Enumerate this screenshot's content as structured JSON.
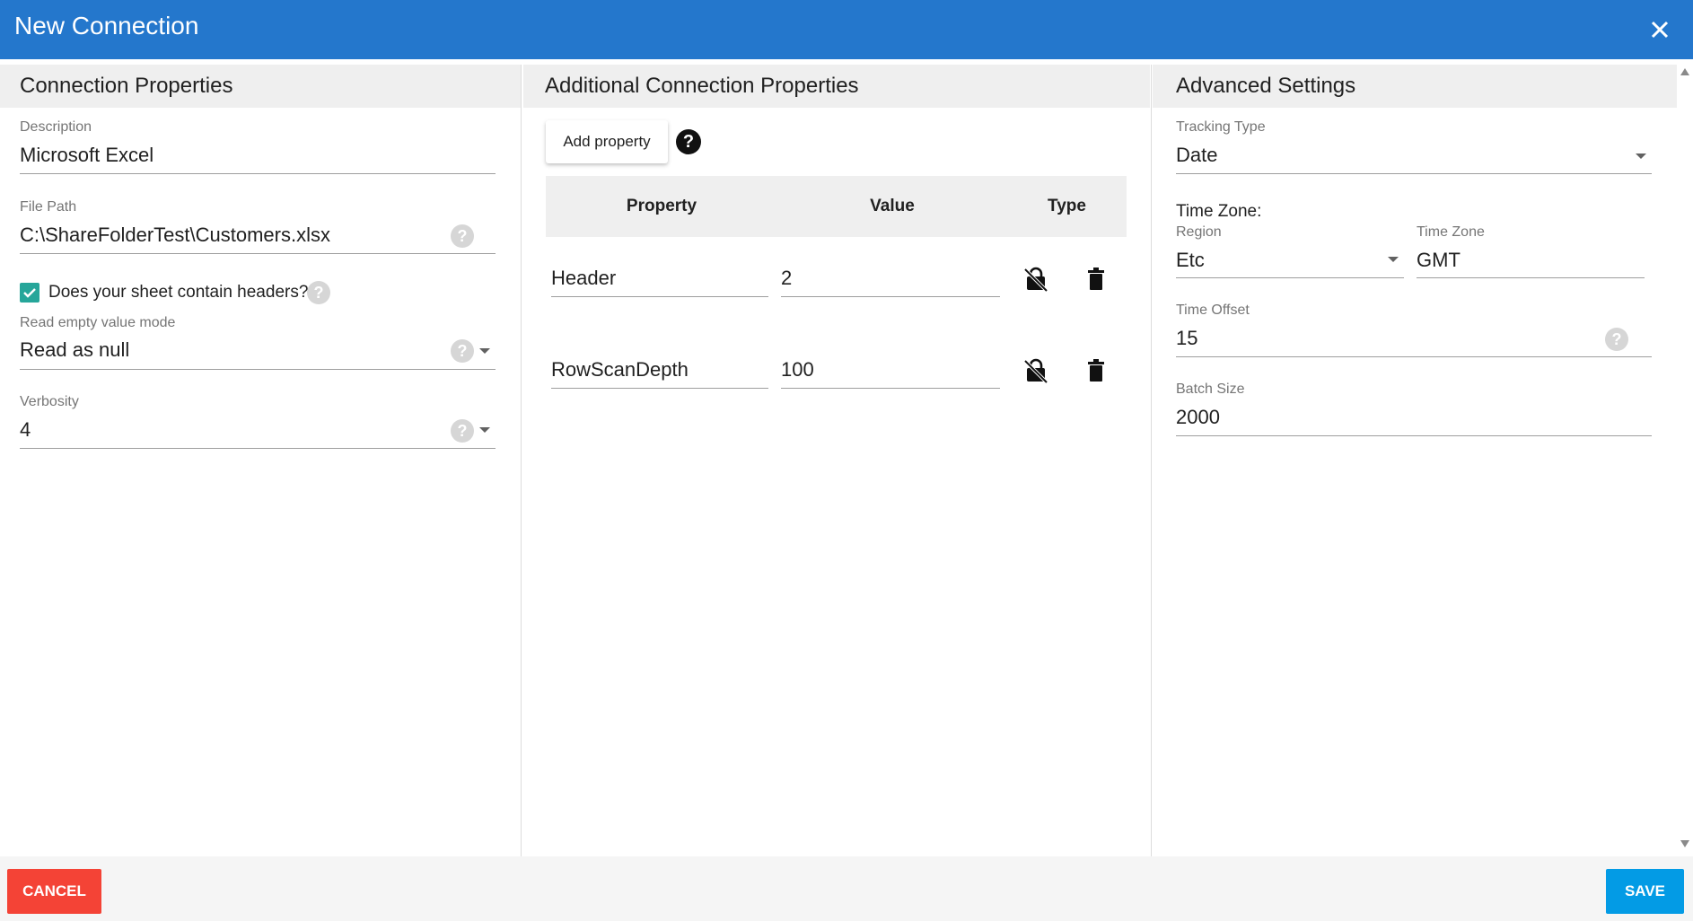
{
  "window": {
    "title": "New Connection",
    "close_icon": "close-icon"
  },
  "colors": {
    "header": "#2477cc",
    "cancel": "#f44336",
    "save": "#039be5",
    "checkbox": "#26a69a"
  },
  "connection_properties": {
    "heading": "Connection Properties",
    "description": {
      "label": "Description",
      "value": "Microsoft Excel"
    },
    "file_path": {
      "label": "File Path",
      "value": "C:\\ShareFolderTest\\Customers.xlsx"
    },
    "headers_checkbox": {
      "label": "Does your sheet contain headers?",
      "checked": true
    },
    "read_empty_mode": {
      "label": "Read empty value mode",
      "value": "Read as null"
    },
    "verbosity": {
      "label": "Verbosity",
      "value": "4"
    }
  },
  "additional_properties": {
    "heading": "Additional Connection Properties",
    "add_button": "Add property",
    "columns": {
      "property": "Property",
      "value": "Value",
      "type": "Type"
    },
    "rows": [
      {
        "property": "Header",
        "value": "2"
      },
      {
        "property": "RowScanDepth",
        "value": "100"
      }
    ]
  },
  "advanced_settings": {
    "heading": "Advanced Settings",
    "tracking_type": {
      "label": "Tracking Type",
      "value": "Date"
    },
    "time_zone_heading": "Time Zone:",
    "region": {
      "label": "Region",
      "value": "Etc"
    },
    "time_zone": {
      "label": "Time Zone",
      "value": "GMT"
    },
    "time_offset": {
      "label": "Time Offset",
      "value": "15"
    },
    "batch_size": {
      "label": "Batch Size",
      "value": "2000"
    }
  },
  "footer": {
    "cancel": "CANCEL",
    "save": "SAVE"
  }
}
